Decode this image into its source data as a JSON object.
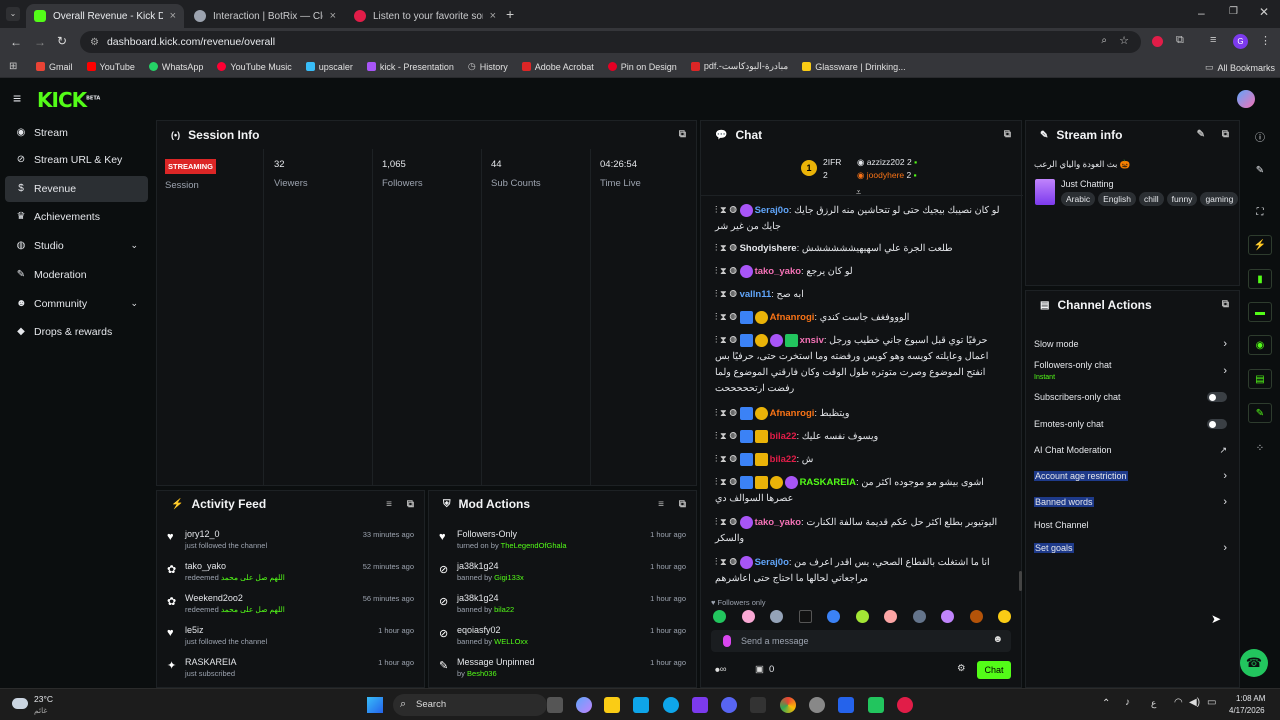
{
  "browser": {
    "tabs": [
      {
        "title": "Overall Revenue - Kick Dashboard",
        "color": "#53fc18"
      },
      {
        "title": "Interaction | BotRix — Cloud Stream Bot",
        "color": "#9ca3af"
      },
      {
        "title": "Listen to your favorite songs and...",
        "color": "#e11d48"
      }
    ],
    "url": "dashboard.kick.com/revenue/overall",
    "bookmarks": [
      "Gmail",
      "YouTube",
      "WhatsApp",
      "YouTube Music",
      "upscaler",
      "kick - Presentation",
      "History",
      "Adobe Acrobat",
      "Pin on Design",
      "pdf.-مبادرة-البودكاست",
      "Glassware | Drinking..."
    ],
    "all_bookmarks": "All Bookmarks",
    "profile_initial": "G"
  },
  "brand": {
    "logo": "KICK",
    "beta": "BETA"
  },
  "sidebar": {
    "items": [
      {
        "label": "Stream",
        "icon": "broadcast-icon"
      },
      {
        "label": "Stream URL & Key",
        "icon": "link-icon"
      },
      {
        "label": "Revenue",
        "icon": "dollar-icon"
      },
      {
        "label": "Achievements",
        "icon": "trophy-icon"
      },
      {
        "label": "Studio",
        "icon": "globe-icon"
      },
      {
        "label": "Moderation",
        "icon": "wrench-icon"
      },
      {
        "label": "Community",
        "icon": "people-icon"
      },
      {
        "label": "Drops & rewards",
        "icon": "gift-icon"
      }
    ]
  },
  "session": {
    "title": "Session Info",
    "status": "STREAMING",
    "status_label": "Session",
    "stats": [
      {
        "value": "32",
        "label": "Viewers"
      },
      {
        "value": "1,065",
        "label": "Followers"
      },
      {
        "value": "44",
        "label": "Sub Counts"
      },
      {
        "value": "04:26:54",
        "label": "Time Live"
      }
    ]
  },
  "activity": {
    "title": "Activity Feed",
    "items": [
      {
        "user": "jory12_0",
        "desc": "just followed the channel",
        "extra": "",
        "time": "33 minutes ago",
        "icon": "heart-icon"
      },
      {
        "user": "tako_yako",
        "desc": "redeemed",
        "extra": "اللهم صل على محمد",
        "time": "52 minutes ago",
        "icon": "gift-icon"
      },
      {
        "user": "Weekend2oo2",
        "desc": "redeemed",
        "extra": "اللهم صل على محمد",
        "time": "56 minutes ago",
        "icon": "gift-icon"
      },
      {
        "user": "le5iz",
        "desc": "just followed the channel",
        "extra": "",
        "time": "1 hour ago",
        "icon": "heart-icon"
      },
      {
        "user": "RASKAREIA",
        "desc": "just subscribed",
        "extra": "",
        "time": "1 hour ago",
        "icon": "star-icon"
      }
    ]
  },
  "mod": {
    "title": "Mod Actions",
    "items": [
      {
        "action": "Followers-Only",
        "desc": "turned on by",
        "by": "TheLegendOfGhala",
        "time": "1 hour ago",
        "icon": "heart-icon"
      },
      {
        "action": "ja38k1g24",
        "desc": "banned by",
        "by": "Gigi133x",
        "time": "1 hour ago",
        "icon": "ban-icon"
      },
      {
        "action": "ja38k1g24",
        "desc": "banned by",
        "by": "bila22",
        "time": "1 hour ago",
        "icon": "ban-icon"
      },
      {
        "action": "eqoiasfy02",
        "desc": "banned by",
        "by": "WELLOxx",
        "time": "1 hour ago",
        "icon": "ban-icon"
      },
      {
        "action": "Message Unpinned",
        "desc": "by",
        "by": "Besh036",
        "time": "1 hour ago",
        "icon": "pin-icon"
      }
    ]
  },
  "chat": {
    "title": "Chat",
    "top_gifters": [
      {
        "name": "2IFR",
        "count": "2"
      },
      {
        "name": "azzizz202",
        "count": "2"
      },
      {
        "name": "joodyhere",
        "count": "2"
      }
    ],
    "messages": [
      {
        "user": "Seraj0o",
        "color": "#60a5fa",
        "text": "لو كان نصيبك بيجيك حتى لو تتحاشين منه الرزق جايك جايك من غير شر"
      },
      {
        "user": "Shodyishere",
        "color": "#e5e7eb",
        "text": "طلعت الجرة علي اسهيهيشششششش"
      },
      {
        "user": "tako_yako",
        "color": "#f472b6",
        "text": "لو كان يرجع"
      },
      {
        "user": "valln11",
        "color": "#60a5fa",
        "text": "ابه صح"
      },
      {
        "user": "Afnanrogi",
        "color": "#f97316",
        "text": "الوووفغف جاست كندي"
      },
      {
        "user": "xnsiv",
        "color": "#f472b6",
        "text": "حرفيًا توي قبل اسبوع جاني خطيب ورجل اعمال وعايلته كويسه وهو كويس ورفضته وما استخرت حتى، حرفيًا بس انفتح الموضوع وصرت متوتره طول الوقت وكان فارقني الموضوع ولما رفضت ارتحححححت"
      },
      {
        "user": "Afnanrogi",
        "color": "#f97316",
        "text": "ويتظبط"
      },
      {
        "user": "bila22",
        "color": "#e11d48",
        "text": "ويسوف نفسه عليك"
      },
      {
        "user": "bila22",
        "color": "#e11d48",
        "text": "ش"
      },
      {
        "user": "RASKAREIA",
        "color": "#53fc18",
        "text": "اشوى بيشو مو موجوده اكثر من عصرها السوالف دي"
      },
      {
        "user": "tako_yako",
        "color": "#f472b6",
        "text": "اليوتيوبر بطلع اكثر حل عكم قديمة سالفة الكنارت والسكر"
      },
      {
        "user": "Seraj0o",
        "color": "#60a5fa",
        "text": "انا ما اشتغلت بالقطاع الصحي، بس اقدر اعرف من مراجعاتي لحالها ما احتاج حتى اعاشرهم"
      }
    ],
    "followers_only": "Followers only",
    "placeholder": "Send a message",
    "points": "0",
    "send_label": "Chat"
  },
  "stream_info": {
    "title": "Stream info",
    "stream_title": "بث العودة والياي الرعب 🎃",
    "category": "Just Chatting",
    "tags": [
      "Arabic",
      "English",
      "chill",
      "funny",
      "gaming"
    ]
  },
  "channel_actions": {
    "title": "Channel Actions",
    "items": [
      {
        "label": "Slow mode",
        "sub": "",
        "kind": "arrow",
        "selected": false
      },
      {
        "label": "Followers-only chat",
        "sub": "Instant",
        "kind": "arrow",
        "selected": false
      },
      {
        "label": "Subscribers-only chat",
        "sub": "",
        "kind": "toggle",
        "selected": false
      },
      {
        "label": "Emotes-only chat",
        "sub": "",
        "kind": "toggle",
        "selected": false
      },
      {
        "label": "AI Chat Moderation",
        "sub": "",
        "kind": "external",
        "selected": false
      },
      {
        "label": "Account age restriction",
        "sub": "",
        "kind": "arrow",
        "selected": true
      },
      {
        "label": "Banned words",
        "sub": "",
        "kind": "arrow",
        "selected": true
      },
      {
        "label": "Host Channel",
        "sub": "",
        "kind": "none",
        "selected": false
      },
      {
        "label": "Set goals",
        "sub": "",
        "kind": "arrow",
        "selected": true
      }
    ]
  },
  "taskbar": {
    "weather_temp": "23°C",
    "weather_desc": "غائم",
    "search": "Search",
    "time": "1:08 AM",
    "date": "4/17/2026",
    "lang": "ع"
  },
  "colors": {
    "accent": "#53fc18",
    "panel": "#101214",
    "bg": "#0b0e0f",
    "selection": "#1e3a8a"
  }
}
